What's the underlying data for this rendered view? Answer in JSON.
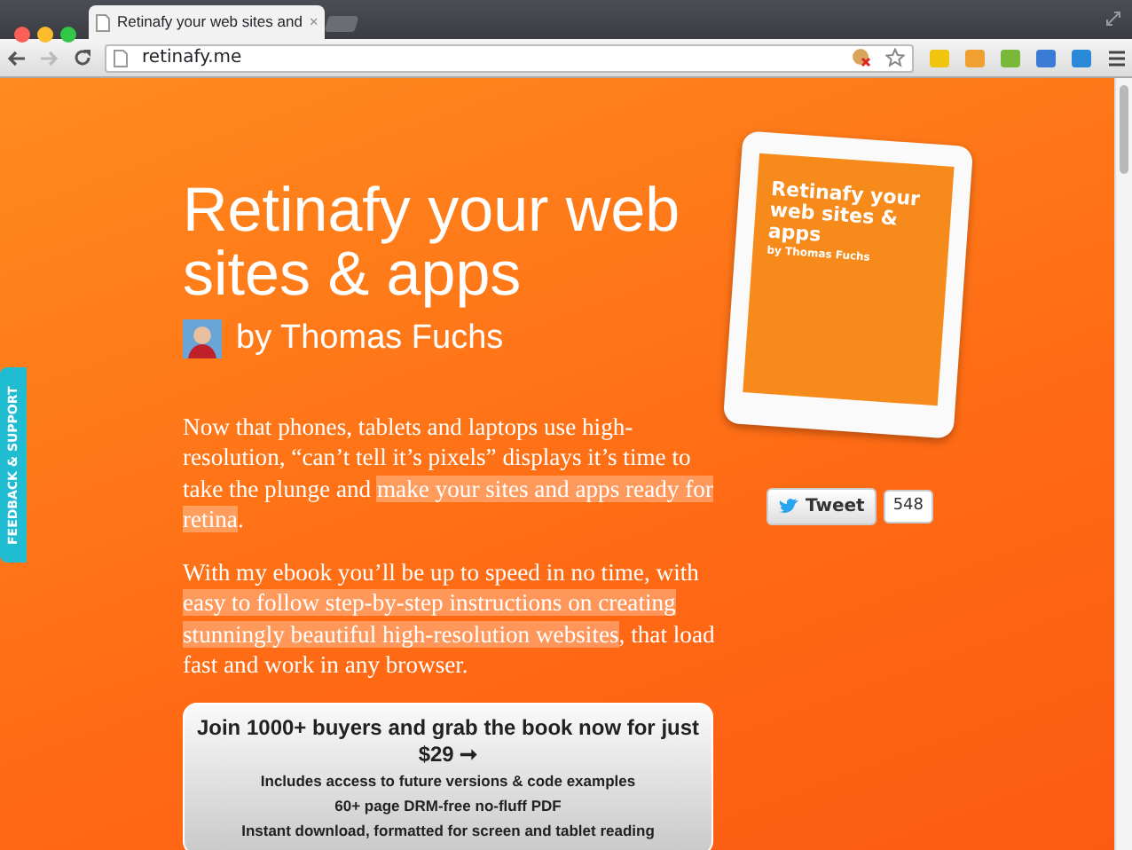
{
  "browser": {
    "tab_title": "Retinafy your web sites and",
    "tab_close": "×",
    "address": "retinafy.me"
  },
  "feedback_tab": {
    "label": "FEEDBACK & SUPPORT"
  },
  "hero": {
    "title": "Retinafy your web sites & apps",
    "byline": "by Thomas Fuchs"
  },
  "paragraphs": [
    {
      "parts": [
        {
          "text": "Now that phones, tablets and laptops use high-resolution, “can’t tell it’s pixels” displays it’s time to take the plunge and ",
          "highlight": false
        },
        {
          "text": "make your sites and apps ready for retina",
          "highlight": true
        },
        {
          "text": ".",
          "highlight": false
        }
      ]
    },
    {
      "parts": [
        {
          "text": "With my ebook you’ll be up to speed in no time, with ",
          "highlight": false
        },
        {
          "text": "easy to follow step-by-step instructions on creating stunningly beautiful high-resolution websites",
          "highlight": true
        },
        {
          "text": ", that load fast and work in any browser.",
          "highlight": false
        }
      ]
    }
  ],
  "buy_box": {
    "headline": "Join 1000+ buyers and grab the book now for just $29 ➞",
    "features": [
      "Includes access to future versions & code examples",
      "60+ page DRM-free no-fluff PDF",
      "Instant download, formatted for screen and tablet reading"
    ]
  },
  "tablet": {
    "title": "Retinafy your web sites & apps",
    "byline": "by Thomas Fuchs"
  },
  "tweet": {
    "label": "Tweet",
    "count": "548"
  }
}
